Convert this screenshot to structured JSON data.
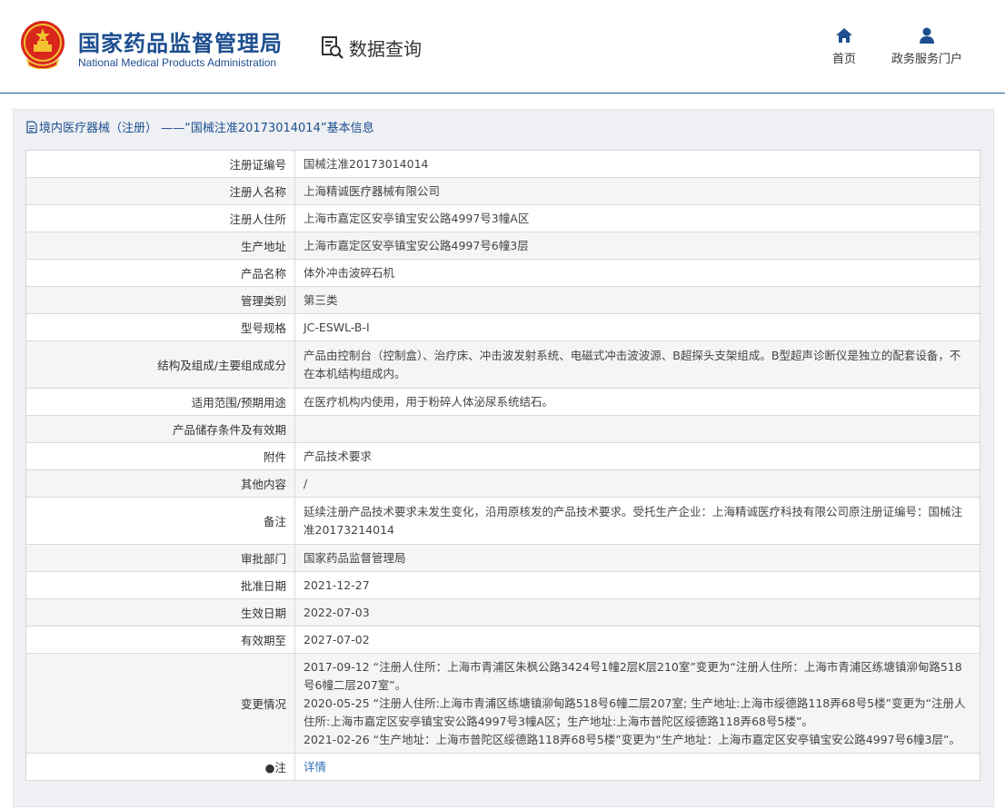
{
  "header": {
    "org_cn": "国家药品监督管理局",
    "org_en": "National Medical Products Administration",
    "query_title": "数据查询",
    "nav": {
      "home": "首页",
      "portal": "政务服务门户"
    },
    "colors": {
      "brand": "#1d4e8f",
      "emblem_red": "#d9261c",
      "emblem_gold": "#f2c230"
    }
  },
  "panel": {
    "title": "境内医疗器械（注册） ——“国械注准20173014014”基本信息",
    "title_icon": "document-icon",
    "rows": [
      {
        "label": "注册证编号",
        "value": "国械注准20173014014"
      },
      {
        "label": "注册人名称",
        "value": "上海精诚医疗器械有限公司"
      },
      {
        "label": "注册人住所",
        "value": "上海市嘉定区安亭镇宝安公路4997号3幢A区"
      },
      {
        "label": "生产地址",
        "value": "上海市嘉定区安亭镇宝安公路4997号6幢3层"
      },
      {
        "label": "产品名称",
        "value": "体外冲击波碎石机"
      },
      {
        "label": "管理类别",
        "value": "第三类"
      },
      {
        "label": "型号规格",
        "value": "JC-ESWL-B-Ⅰ"
      },
      {
        "label": "结构及组成/主要组成成分",
        "value": "产品由控制台（控制盒）、治疗床、冲击波发射系统、电磁式冲击波波源、B超探头支架组成。B型超声诊断仪是独立的配套设备，不在本机结构组成内。"
      },
      {
        "label": "适用范围/预期用途",
        "value": "在医疗机构内使用，用于粉碎人体泌尿系统结石。"
      },
      {
        "label": "产品储存条件及有效期",
        "value": ""
      },
      {
        "label": "附件",
        "value": "产品技术要求"
      },
      {
        "label": "其他内容",
        "value": "/"
      },
      {
        "label": "备注",
        "value": "延续注册产品技术要求未发生变化，沿用原核发的产品技术要求。受托生产企业：上海精诚医疗科技有限公司原注册证编号：国械注准20173214014"
      },
      {
        "label": "审批部门",
        "value": "国家药品监督管理局"
      },
      {
        "label": "批准日期",
        "value": "2021-12-27"
      },
      {
        "label": "生效日期",
        "value": "2022-07-03"
      },
      {
        "label": "有效期至",
        "value": "2027-07-02"
      },
      {
        "label": "变更情况",
        "value_lines": [
          "2017-09-12 “注册人住所：上海市青浦区朱枫公路3424号1幢2层K层210室”变更为“注册人住所：上海市青浦区练塘镇泖甸路518号6幢二层207室”。",
          "2020-05-25 “注册人住所:上海市青浦区练塘镇泖甸路518号6幢二层207室; 生产地址:上海市绥德路118弄68号5楼”变更为“注册人住所:上海市嘉定区安亭镇宝安公路4997号3幢A区；生产地址:上海市普陀区绥德路118弄68号5楼”。",
          "2021-02-26 “生产地址：上海市普陀区绥德路118弄68号5楼”变更为“生产地址：上海市嘉定区安亭镇宝安公路4997号6幢3层”。"
        ]
      },
      {
        "label": "●注",
        "value": "详情"
      }
    ]
  }
}
